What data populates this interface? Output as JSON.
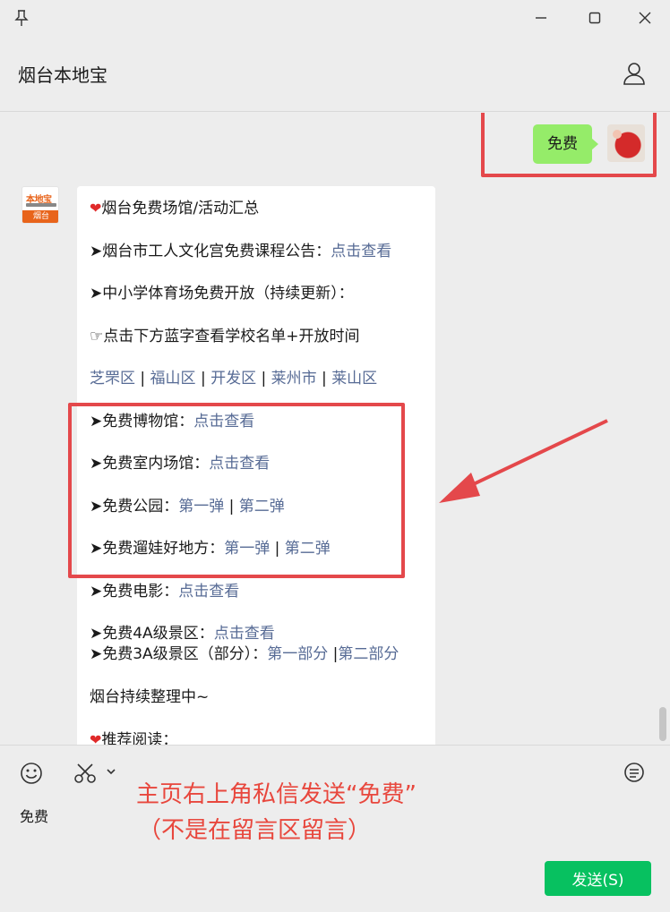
{
  "window": {
    "title": "烟台本地宝"
  },
  "chat": {
    "sent_message": "免费",
    "bot_avatar": {
      "brand_top": "本地宝",
      "brand_bottom": "烟台"
    },
    "lines": [
      {
        "icon": "heart",
        "text": "烟台免费场馆/活动汇总",
        "links": []
      },
      {
        "text": "➤烟台市工人文化宫免费课程公告：",
        "links": [
          "点击查看"
        ]
      },
      {
        "text": "➤中小学体育场免费开放（持续更新）：",
        "links": []
      },
      {
        "text": "☞点击下方蓝字查看学校名单+开放时间",
        "links": []
      },
      {
        "text": "",
        "links": [
          "芝罘区",
          "福山区",
          "开发区",
          "莱州市",
          "莱山区"
        ]
      },
      {
        "text": "➤免费博物馆：",
        "links": [
          "点击查看"
        ]
      },
      {
        "text": "➤免费室内场馆：",
        "links": [
          "点击查看"
        ]
      },
      {
        "text": "➤免费公园：",
        "links": [
          "第一弹",
          "第二弹"
        ]
      },
      {
        "text": "➤免费遛娃好地方：",
        "links": [
          "第一弹",
          "第二弹"
        ]
      },
      {
        "text": "➤免费电影：",
        "links": [
          "点击查看"
        ]
      },
      {
        "text": "➤免费4A级景区：",
        "links": [
          "点击查看"
        ]
      },
      {
        "text": "➤免费3A级景区（部分）：",
        "links": [
          "第一部分",
          "第二部分"
        ]
      },
      {
        "text": "烟台持续整理中~",
        "links": []
      },
      {
        "icon": "heart",
        "text": "推荐阅读：",
        "links": []
      }
    ]
  },
  "input": {
    "text": "免费",
    "send_label": "发送(S)"
  },
  "annotation": {
    "line1": "主页右上角私信发送“免费”",
    "line2": "（不是在留言区留言）"
  },
  "colors": {
    "sent_bubble": "#95ec69",
    "link": "#576b95",
    "highlight": "#e4484b",
    "send_button": "#07c160",
    "annotation_text": "#e8473d"
  }
}
